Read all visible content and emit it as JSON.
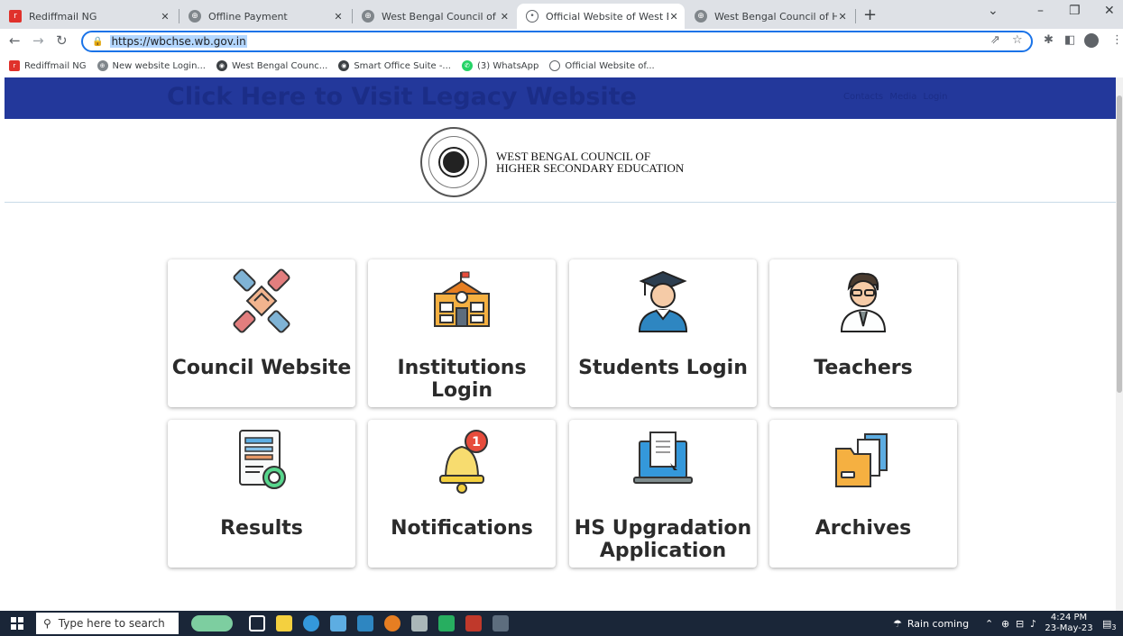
{
  "browser": {
    "tabs": [
      {
        "title": "Rediffmail NG",
        "active": false
      },
      {
        "title": "Offline Payment",
        "active": false
      },
      {
        "title": "West Bengal Council of Higher Se",
        "active": false
      },
      {
        "title": "Official Website of West Bengal C",
        "active": true
      },
      {
        "title": "West Bengal Council of Higher Se",
        "active": false
      }
    ],
    "new_tab": "+",
    "address": {
      "url": "https://wbchse.wb.gov.in"
    },
    "bookmarks": [
      "Rediffmail NG",
      "New website Login...",
      "West Bengal Counc...",
      "Smart Office Suite -...",
      "(3) WhatsApp",
      "Official Website of..."
    ]
  },
  "page": {
    "legacy_link": "Click Here to Visit Legacy Website",
    "top_links": [
      "Contacts",
      "Media",
      "Login"
    ],
    "brand": {
      "line1": "WEST BENGAL COUNCIL OF",
      "line2": "HIGHER SECONDARY EDUCATION"
    },
    "cards": [
      {
        "label": "Council Website",
        "icon": "handshake-icon"
      },
      {
        "label": "Institutions Login",
        "icon": "school-building-icon"
      },
      {
        "label": "Students Login",
        "icon": "graduate-student-icon"
      },
      {
        "label": "Teachers",
        "icon": "teacher-icon"
      },
      {
        "label": "Results",
        "icon": "result-document-icon"
      },
      {
        "label": "Notifications",
        "icon": "notification-bell-icon",
        "badge": "1"
      },
      {
        "label": "HS Upgradation Application",
        "icon": "laptop-document-icon"
      },
      {
        "label": "Archives",
        "icon": "folder-archive-icon"
      }
    ]
  },
  "taskbar": {
    "search_placeholder": "Type here to search",
    "weather": "Rain coming",
    "time": "4:24 PM",
    "date": "23-May-23",
    "notification_count": "3"
  },
  "colors": {
    "banner": "#23389b",
    "banner_text": "#1b2d87",
    "omnibox_border": "#1a73e8",
    "taskbar": "#1a2638"
  }
}
